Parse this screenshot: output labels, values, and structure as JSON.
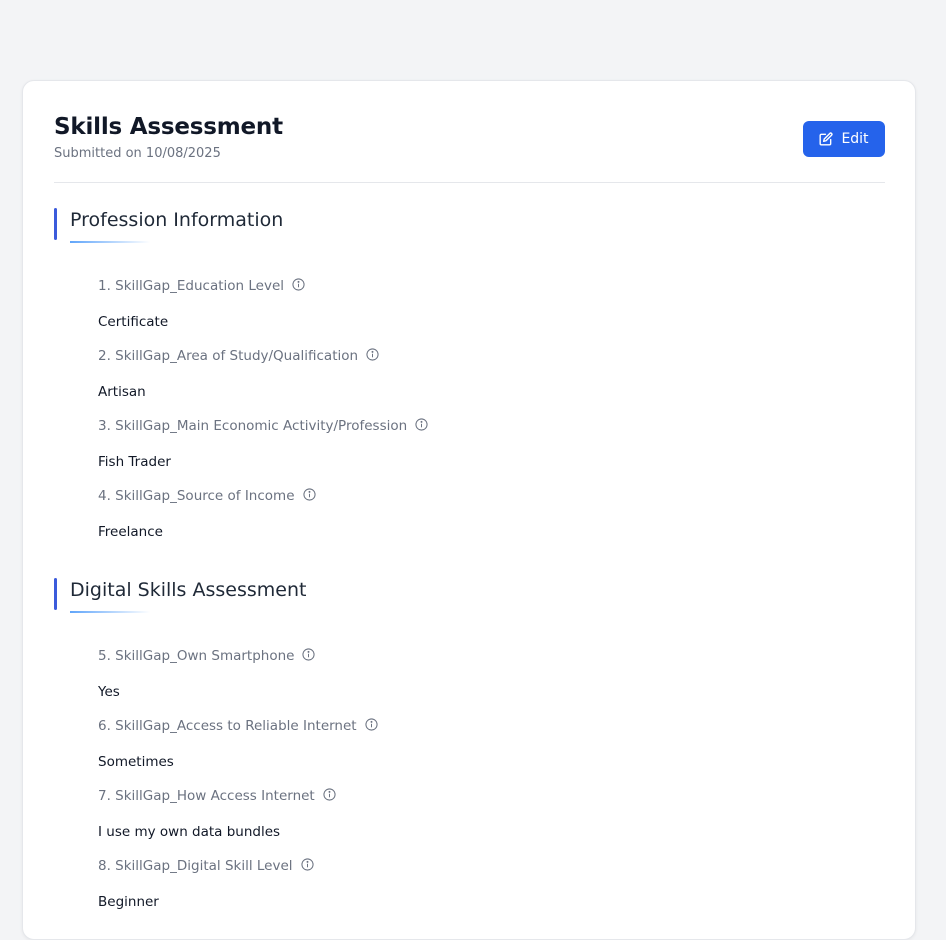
{
  "page": {
    "title": "Skills Assessment",
    "submitted": "Submitted on 10/08/2025",
    "edit_label": "Edit"
  },
  "sections": [
    {
      "title": "Profession Information",
      "questions": [
        {
          "label": "1. SkillGap_Education Level",
          "answer": "Certificate"
        },
        {
          "label": "2. SkillGap_Area of Study/Qualification",
          "answer": "Artisan"
        },
        {
          "label": "3. SkillGap_Main Economic Activity/Profession",
          "answer": "Fish Trader"
        },
        {
          "label": "4. SkillGap_Source of Income",
          "answer": "Freelance"
        }
      ]
    },
    {
      "title": "Digital Skills Assessment",
      "questions": [
        {
          "label": "5. SkillGap_Own Smartphone",
          "answer": "Yes"
        },
        {
          "label": "6. SkillGap_Access to Reliable Internet",
          "answer": "Sometimes"
        },
        {
          "label": "7. SkillGap_How Access Internet",
          "answer": "I use my own data bundles"
        },
        {
          "label": "8. SkillGap_Digital Skill Level",
          "answer": "Beginner"
        }
      ]
    }
  ],
  "icons": {
    "edit": "edit-icon",
    "info": "info-icon"
  },
  "colors": {
    "accent": "#2563eb",
    "section_bar": "#3b5bdb",
    "background": "#f3f4f6"
  }
}
